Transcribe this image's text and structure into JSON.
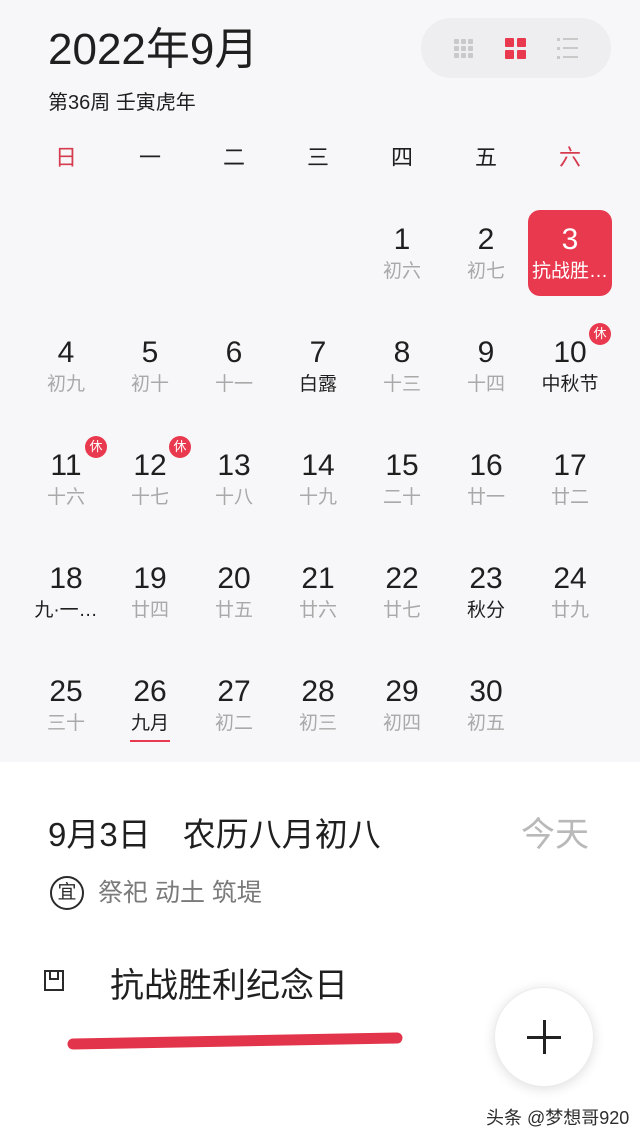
{
  "header": {
    "title": "2022年9月",
    "subtitle": "第36周 壬寅虎年"
  },
  "view_switcher": [
    {
      "icon": "nine-grid-icon",
      "selected": false
    },
    {
      "icon": "four-grid-icon",
      "selected": true
    },
    {
      "icon": "list-icon",
      "selected": false
    }
  ],
  "colors": {
    "accent": "#e8394e",
    "weekend": "#d63c4f",
    "lunar_text": "#a9a9a9",
    "text": "#1f1f1f",
    "calendar_background": "#f7f7f9"
  },
  "weekdays": [
    {
      "label": "日",
      "weekend": true
    },
    {
      "label": "一",
      "weekend": false
    },
    {
      "label": "二",
      "weekend": false
    },
    {
      "label": "三",
      "weekend": false
    },
    {
      "label": "四",
      "weekend": false
    },
    {
      "label": "五",
      "weekend": false
    },
    {
      "label": "六",
      "weekend": true
    }
  ],
  "calendar": {
    "weeks": [
      [
        null,
        null,
        null,
        null,
        {
          "day": 1,
          "lunar": "初六"
        },
        {
          "day": 2,
          "lunar": "初七"
        },
        {
          "day": 3,
          "lunar": "抗战胜…",
          "selected": true
        }
      ],
      [
        {
          "day": 4,
          "lunar": "初九"
        },
        {
          "day": 5,
          "lunar": "初十"
        },
        {
          "day": 6,
          "lunar": "十一"
        },
        {
          "day": 7,
          "lunar": "白露",
          "festival": true
        },
        {
          "day": 8,
          "lunar": "十三"
        },
        {
          "day": 9,
          "lunar": "十四"
        },
        {
          "day": 10,
          "lunar": "中秋节",
          "festival": true,
          "badge": "休"
        }
      ],
      [
        {
          "day": 11,
          "lunar": "十六",
          "badge": "休"
        },
        {
          "day": 12,
          "lunar": "十七",
          "badge": "休"
        },
        {
          "day": 13,
          "lunar": "十八"
        },
        {
          "day": 14,
          "lunar": "十九"
        },
        {
          "day": 15,
          "lunar": "二十"
        },
        {
          "day": 16,
          "lunar": "廿一"
        },
        {
          "day": 17,
          "lunar": "廿二"
        }
      ],
      [
        {
          "day": 18,
          "lunar": "九·一…",
          "festival": true
        },
        {
          "day": 19,
          "lunar": "廿四"
        },
        {
          "day": 20,
          "lunar": "廿五"
        },
        {
          "day": 21,
          "lunar": "廿六"
        },
        {
          "day": 22,
          "lunar": "廿七"
        },
        {
          "day": 23,
          "lunar": "秋分",
          "festival": true
        },
        {
          "day": 24,
          "lunar": "廿九"
        }
      ],
      [
        {
          "day": 25,
          "lunar": "三十"
        },
        {
          "day": 26,
          "lunar": "九月",
          "festival": true,
          "underlined": true
        },
        {
          "day": 27,
          "lunar": "初二"
        },
        {
          "day": 28,
          "lunar": "初三"
        },
        {
          "day": 29,
          "lunar": "初四"
        },
        {
          "day": 30,
          "lunar": "初五"
        },
        null
      ]
    ]
  },
  "day_detail": {
    "date": "9月3日",
    "lunar_date": "农历八月初八",
    "today_button": "今天",
    "yi_badge": "宜",
    "yi_activities": "祭祀 动土 筑堤",
    "event": {
      "icon": "event-type-icon",
      "title": "抗战胜利纪念日"
    }
  },
  "fab": {
    "icon": "plus-icon"
  },
  "watermark": "头条 @梦想哥920"
}
